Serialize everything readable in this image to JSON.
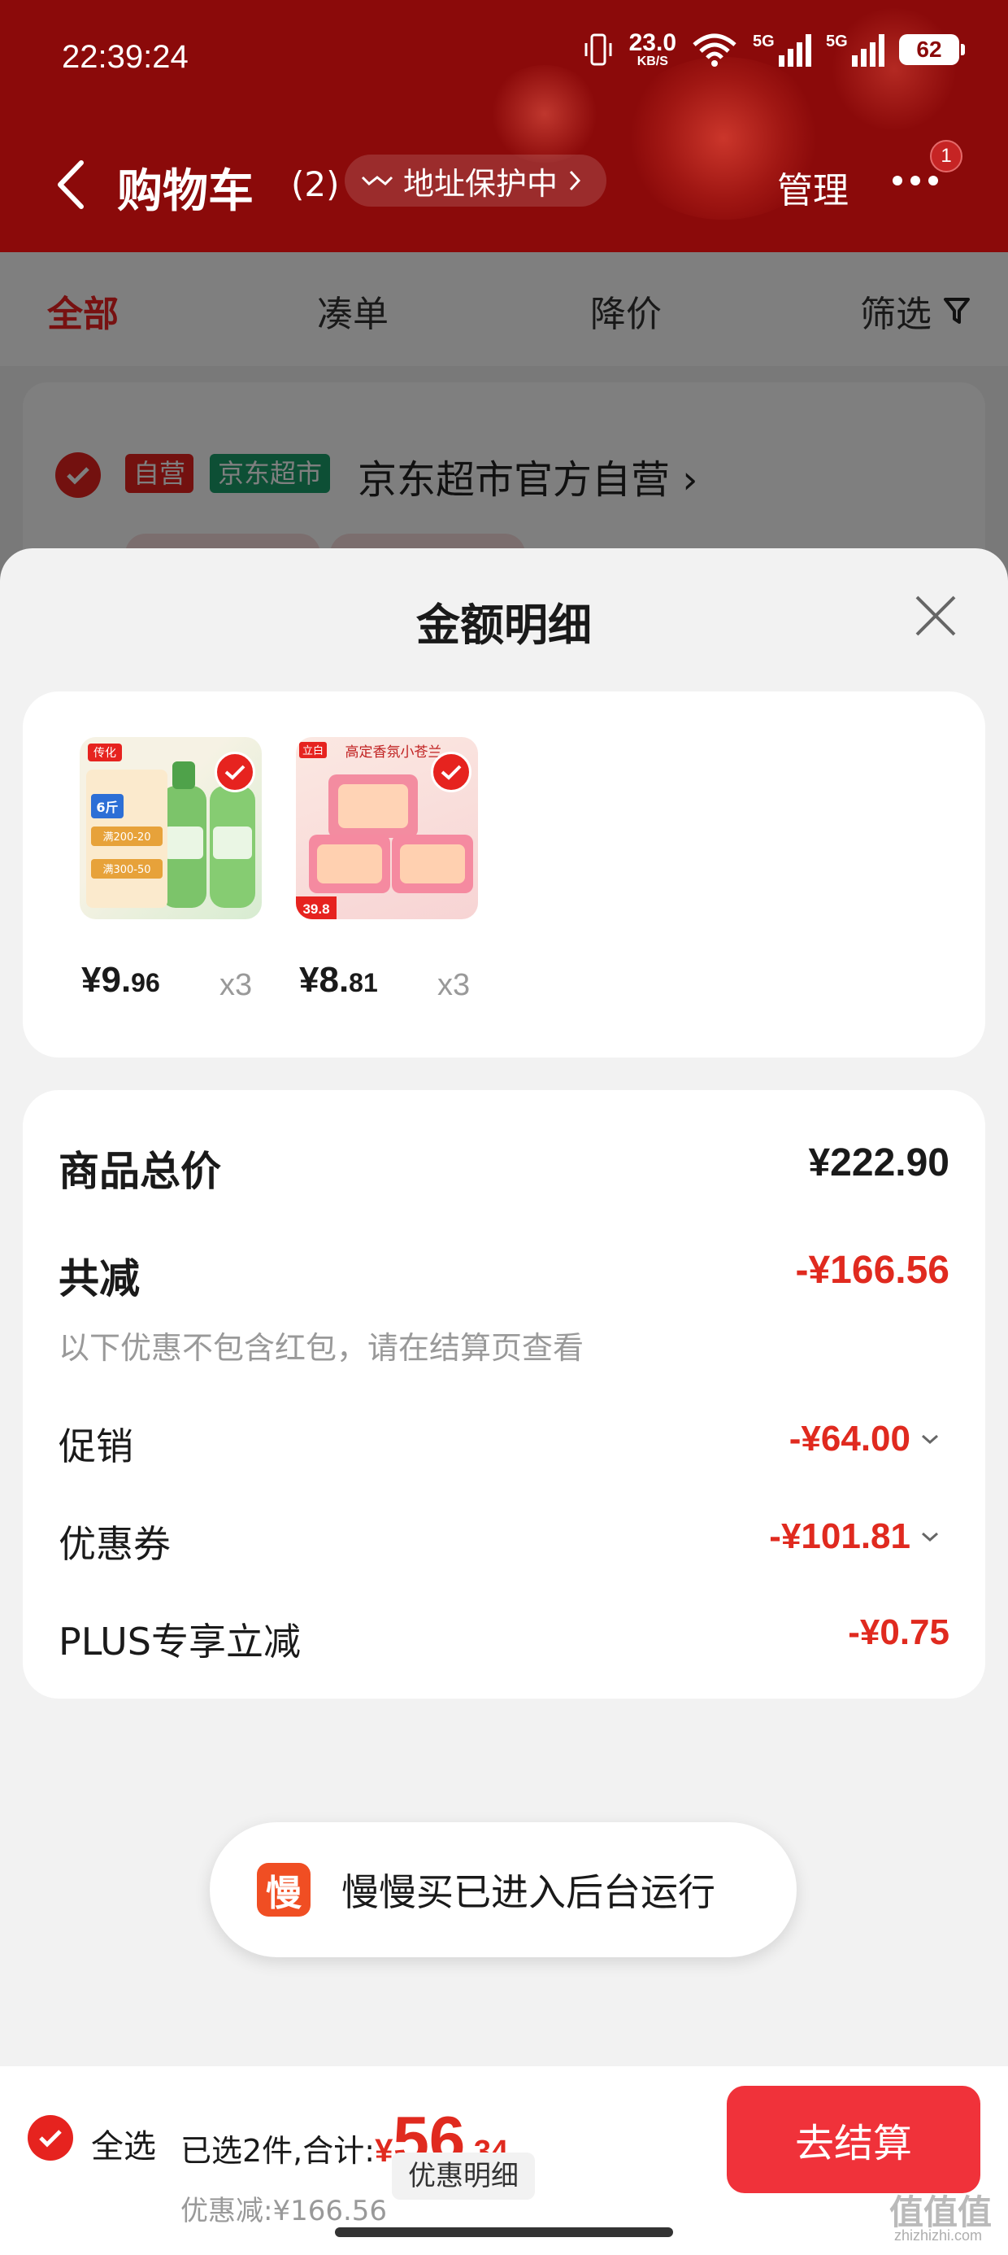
{
  "status_bar": {
    "time": "22:39:24",
    "net_speed": "23.0",
    "net_unit": "KB/S",
    "signal1": "5G",
    "signal2": "5G",
    "battery": "62"
  },
  "header": {
    "title": "购物车",
    "count": "(2)",
    "address_protect": "地址保护中",
    "manage": "管理",
    "more_badge": "1"
  },
  "tabs": [
    {
      "label": "全部",
      "active": true
    },
    {
      "label": "凑单"
    },
    {
      "label": "降价"
    },
    {
      "label": "筛选"
    }
  ],
  "store": {
    "tag_self": "自营",
    "tag_market": "京东超市",
    "name": "京东超市官方自营",
    "chevron": "›"
  },
  "sheet": {
    "title": "金额明细",
    "products": [
      {
        "price_int": "¥9.",
        "price_dec": "96",
        "qty": "x3",
        "brand_text": "传化",
        "badge": "6斤",
        "promo1": "满200-20",
        "promo2": "满300-50"
      },
      {
        "price_int": "¥8.",
        "price_dec": "81",
        "qty": "x3",
        "brand_text": "立白",
        "banner": "高定香氛小苍兰",
        "tag": "39.8"
      }
    ],
    "summary": {
      "total_label": "商品总价",
      "total_value": "¥222.90",
      "reduce_label": "共减",
      "reduce_value": "-¥166.56",
      "note": "以下优惠不包含红包，请在结算页查看",
      "promo_label": "促销",
      "promo_value": "-¥64.00",
      "coupon_label": "优惠券",
      "coupon_value": "-¥101.81",
      "plus_label": "PLUS专享立减",
      "plus_value": "-¥0.75"
    }
  },
  "toast": {
    "icon_char": "慢",
    "text": "慢慢买已进入后台运行"
  },
  "bottom_bar": {
    "select_all": "全选",
    "selected_summary": "已选2件,合计:",
    "currency": "¥",
    "total_int": "56",
    "total_dec": ".34",
    "discount_text": "优惠减:¥166.56",
    "detail_button": "优惠明细",
    "checkout": "去结算"
  },
  "watermark": {
    "main": "值值值",
    "sub": "zhizhizhi.com"
  },
  "colors": {
    "header_bg": "#8b0a0a",
    "accent_red": "#e02a1f",
    "market_green": "#1a9e6a",
    "checkout_red": "#f0323a"
  }
}
